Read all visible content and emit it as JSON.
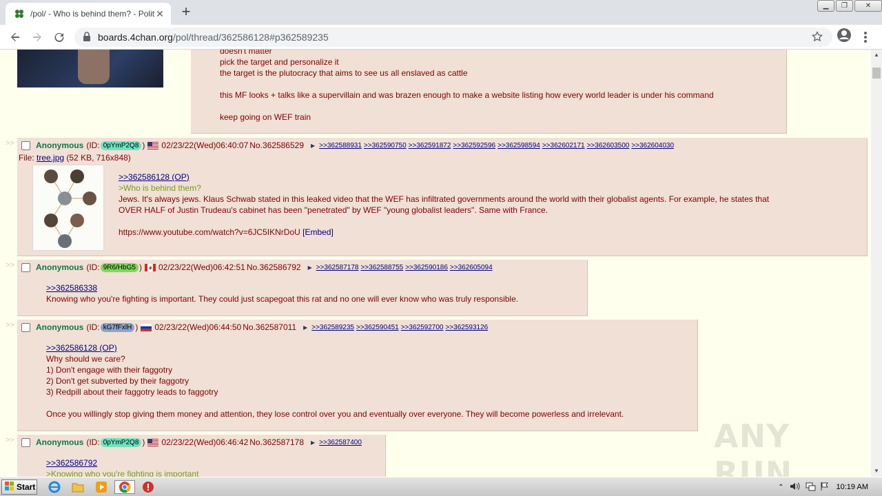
{
  "browser": {
    "tab_title": "/pol/ - Who is behind them? - Politica",
    "url_host": "boards.4chan.org",
    "url_path": "/pol/thread/362586128#p362589235"
  },
  "prev_post": {
    "lines": [
      "doesn't matter",
      "pick the target and personalize it",
      "the target is the plutocracy that aims to see us all enslaved as cattle",
      "",
      "this MF looks + talks like a supervillain and was brazen enough to make a website listing how every world leader is under his command",
      "",
      "keep going on WEF train"
    ]
  },
  "posts": [
    {
      "name": "Anonymous",
      "id_prefix": "(ID:",
      "id": "0pYmP2Q8",
      "id_suffix": ")",
      "id_color": "#6fe3c0",
      "flag": "us-flag",
      "datetime": "02/23/22(Wed)06:40:07",
      "postnum": "No.362586529",
      "backlinks": [
        ">>362588931",
        ">>362590750",
        ">>362591872",
        ">>362592596",
        ">>362598594",
        ">>362602171",
        ">>362603500",
        ">>362604030"
      ],
      "file_label": "File:",
      "file_name": "tree.jpg",
      "file_info": "(52 KB, 716x848)",
      "quote": ">>362586128 (OP)",
      "greentext": ">Who is behind them?",
      "lines": [
        "Jews. It's always jews. Klaus Schwab stated in this leaked video that the WEF has infiltrated governments around the world with their globalist agents. For example, he states that",
        "OVER HALF of Justin Trudeau's cabinet has been \"penetrated\" by WEF \"young globalist leaders\". Same with France.",
        "",
        "https://www.youtube.com/watch?v=6JC5IKNrDoU"
      ],
      "embed_label": "[Embed]"
    },
    {
      "name": "Anonymous",
      "id_prefix": "(ID:",
      "id": "9R6/HbG5",
      "id_suffix": ")",
      "id_color": "#7ed957",
      "flag": "ca-flag",
      "datetime": "02/23/22(Wed)06:42:51",
      "postnum": "No.362586792",
      "backlinks": [
        ">>362587178",
        ">>362588755",
        ">>362590186",
        ">>362605094"
      ],
      "quote": ">>362586338",
      "lines": [
        "Knowing who you're fighting is important. They could just scapegoat this rat and no one will ever know who was truly responsible."
      ]
    },
    {
      "name": "Anonymous",
      "id_prefix": "(ID:",
      "id": "kG7fFxlH",
      "id_suffix": ")",
      "id_color": "#8fa3c9",
      "flag": "ru-flag",
      "datetime": "02/23/22(Wed)06:44:50",
      "postnum": "No.362587011",
      "backlinks": [
        ">>362589235",
        ">>362590451",
        ">>362592700",
        ">>362593126"
      ],
      "quote": ">>362586128 (OP)",
      "lines": [
        "Why should we care?",
        "1) Don't engage with their faggotry",
        "2) Don't get subverted by their faggotry",
        "3) Redpill about their faggotry leads to faggotry",
        "",
        "Once you willingly stop giving them money and attention, they lose control over you and eventually over everyone. They will become powerless and irrelevant."
      ]
    },
    {
      "name": "Anonymous",
      "id_prefix": "(ID:",
      "id": "0pYmP2Q8",
      "id_suffix": ")",
      "id_color": "#6fe3c0",
      "flag": "us-flag",
      "datetime": "02/23/22(Wed)06:46:42",
      "postnum": "No.362587178",
      "backlinks": [
        ">>362587400"
      ],
      "quote": ">>362586792",
      "greentext": ">Knowing who you're fighting is important"
    }
  ],
  "side_arrows": ">>",
  "taskbar": {
    "start_label": "Start",
    "clock": "10:19 AM"
  },
  "watermark": "ANY RUN"
}
